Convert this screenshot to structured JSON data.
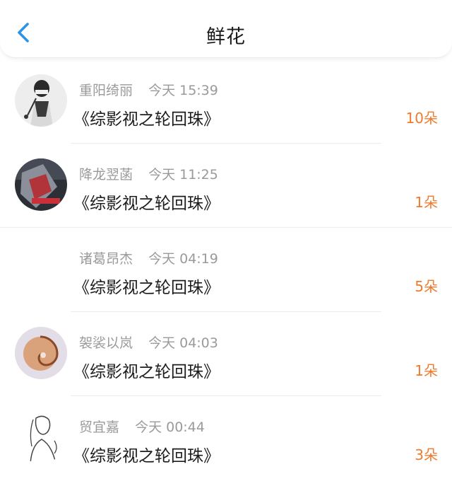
{
  "header": {
    "title": "鲜花",
    "back_icon": "chevron-left-icon",
    "accent": "#2b93e8"
  },
  "colors": {
    "count": "#f07a2c",
    "meta": "#9a9a9a"
  },
  "items": [
    {
      "name": "重阳绮丽",
      "time": "今天 15:39",
      "book": "《综影视之轮回珠》",
      "count": "10朵",
      "avatar": "sketch-girl-avatar"
    },
    {
      "name": "降龙翌菡",
      "time": "今天 11:25",
      "book": "《综影视之轮回珠》",
      "count": "1朵",
      "avatar": "dark-photo-avatar"
    },
    {
      "name": "诸葛昂杰",
      "time": "今天 04:19",
      "book": "《综影视之轮回珠》",
      "count": "5朵",
      "avatar": "blank-avatar"
    },
    {
      "name": "袈裟以岚",
      "time": "今天 04:03",
      "book": "《综影视之轮回珠》",
      "count": "1朵",
      "avatar": "nautilus-shell-avatar"
    },
    {
      "name": "贸宜嘉",
      "time": "今天 00:44",
      "book": "《综影视之轮回珠》",
      "count": "3朵",
      "avatar": "line-sketch-avatar"
    }
  ]
}
